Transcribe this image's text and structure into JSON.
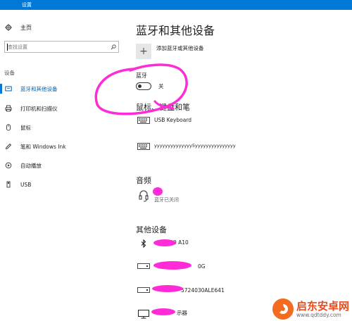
{
  "window": {
    "title": "设置"
  },
  "sidebar": {
    "home_label": "主页",
    "search_placeholder": "查找设置",
    "section_label": "设备",
    "items": [
      {
        "label": "蓝牙和其他设备",
        "icon": "bluetooth-devices-icon",
        "active": true
      },
      {
        "label": "打印机和扫描仪",
        "icon": "printer-icon",
        "active": false
      },
      {
        "label": "鼠标",
        "icon": "mouse-icon",
        "active": false
      },
      {
        "label": "笔和 Windows Ink",
        "icon": "pen-icon",
        "active": false
      },
      {
        "label": "自动播放",
        "icon": "autoplay-icon",
        "active": false
      },
      {
        "label": "USB",
        "icon": "usb-icon",
        "active": false
      }
    ]
  },
  "main": {
    "title": "蓝牙和其他设备",
    "add_device_label": "添加蓝牙或其他设备",
    "bluetooth": {
      "label": "蓝牙",
      "state_label": "关",
      "on": false
    },
    "mouse_keyboard": {
      "title": "鼠标、键盘和笔",
      "devices": [
        {
          "name": "USB Keyboard",
          "icon": "keyboard-icon"
        },
        {
          "name": "yyyyyyyyyyyyyy5yyyyyyyyyyyyyyy",
          "icon": "keyboard-icon"
        }
      ]
    },
    "audio": {
      "title": "音频",
      "devices": [
        {
          "name": "",
          "status": "蓝牙已关闭",
          "icon": "headset-icon"
        }
      ]
    },
    "other": {
      "title": "其他设备",
      "devices": [
        {
          "name": "0 A10",
          "icon": "bluetooth-icon"
        },
        {
          "name": "0G",
          "icon": "drive-icon"
        },
        {
          "name": "5724030ALE641",
          "icon": "drive-icon"
        },
        {
          "name": "示器",
          "icon": "monitor-icon"
        }
      ]
    }
  },
  "watermark": {
    "title": "启东安卓网",
    "url": "www.qdtddy.com"
  },
  "colors": {
    "accent": "#0078d7",
    "active_text": "#0063b1",
    "scribble": "#ff2bd6"
  }
}
